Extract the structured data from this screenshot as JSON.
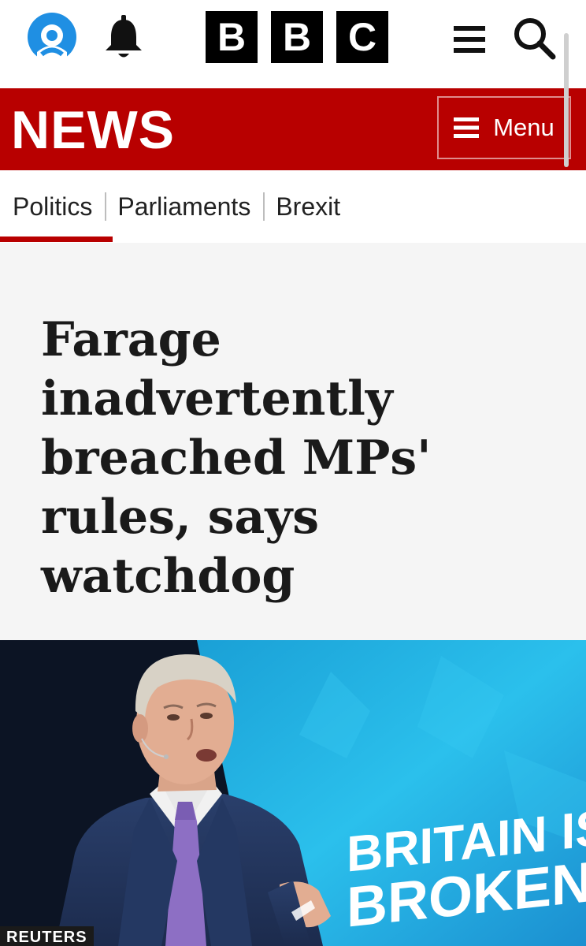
{
  "header": {
    "logo_letters": [
      "B",
      "B",
      "C"
    ],
    "icons": {
      "account": "account-icon",
      "notifications": "bell-icon",
      "menu": "hamburger-icon",
      "search": "search-icon"
    }
  },
  "news_bar": {
    "title": "NEWS",
    "menu_label": "Menu"
  },
  "subnav": {
    "items": [
      "Politics",
      "Parliaments",
      "Brexit"
    ],
    "active": "Politics"
  },
  "article": {
    "headline": "Farage inadvertently breached MPs' rules, says watchdog",
    "image": {
      "sign_text_line1": "BRITAIN IS",
      "sign_text_line2": "BROKEN",
      "credit": "REUTERS"
    }
  },
  "colors": {
    "brand_red": "#b80000",
    "headline_bg": "#f5f5f5",
    "account_blue": "#1f8fe3"
  }
}
